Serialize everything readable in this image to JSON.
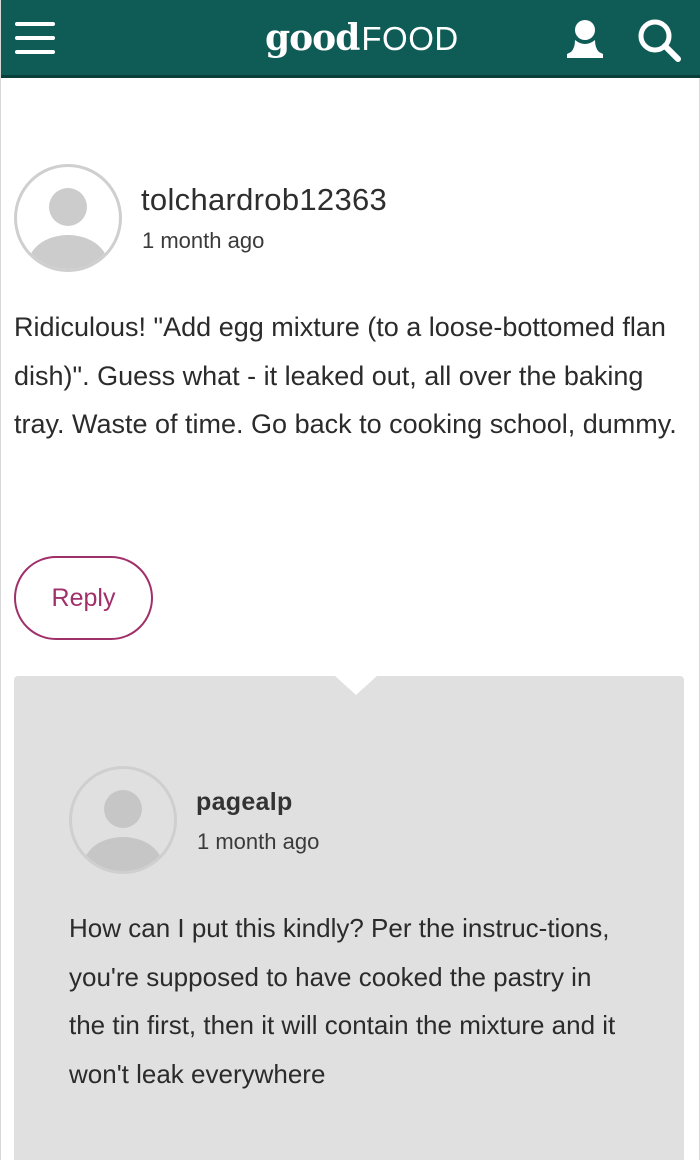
{
  "header": {
    "logo_good": "good",
    "logo_food": "FOOD",
    "bg_color": "#0f5c57",
    "icons": [
      "menu-icon",
      "user-icon",
      "search-icon"
    ]
  },
  "comment": {
    "username": "tolchardrob12363",
    "time": "1 month ago",
    "text": "Ridiculous! \"Add egg mixture (to a loose-bottomed flan dish)\". Guess what - it leaked out, all over the baking tray. Waste of time. Go back to cooking school, dummy.",
    "reply_label": "Reply",
    "accent_color": "#a0306a"
  },
  "reply": {
    "username": "pagealp",
    "time": "1 month ago",
    "text": "How can I put this kindly? Per the instruc-tions, you're supposed to have cooked the pastry in the tin first, then it will contain the mixture and it won't leak everywhere",
    "panel_color": "#e0e0e0"
  }
}
